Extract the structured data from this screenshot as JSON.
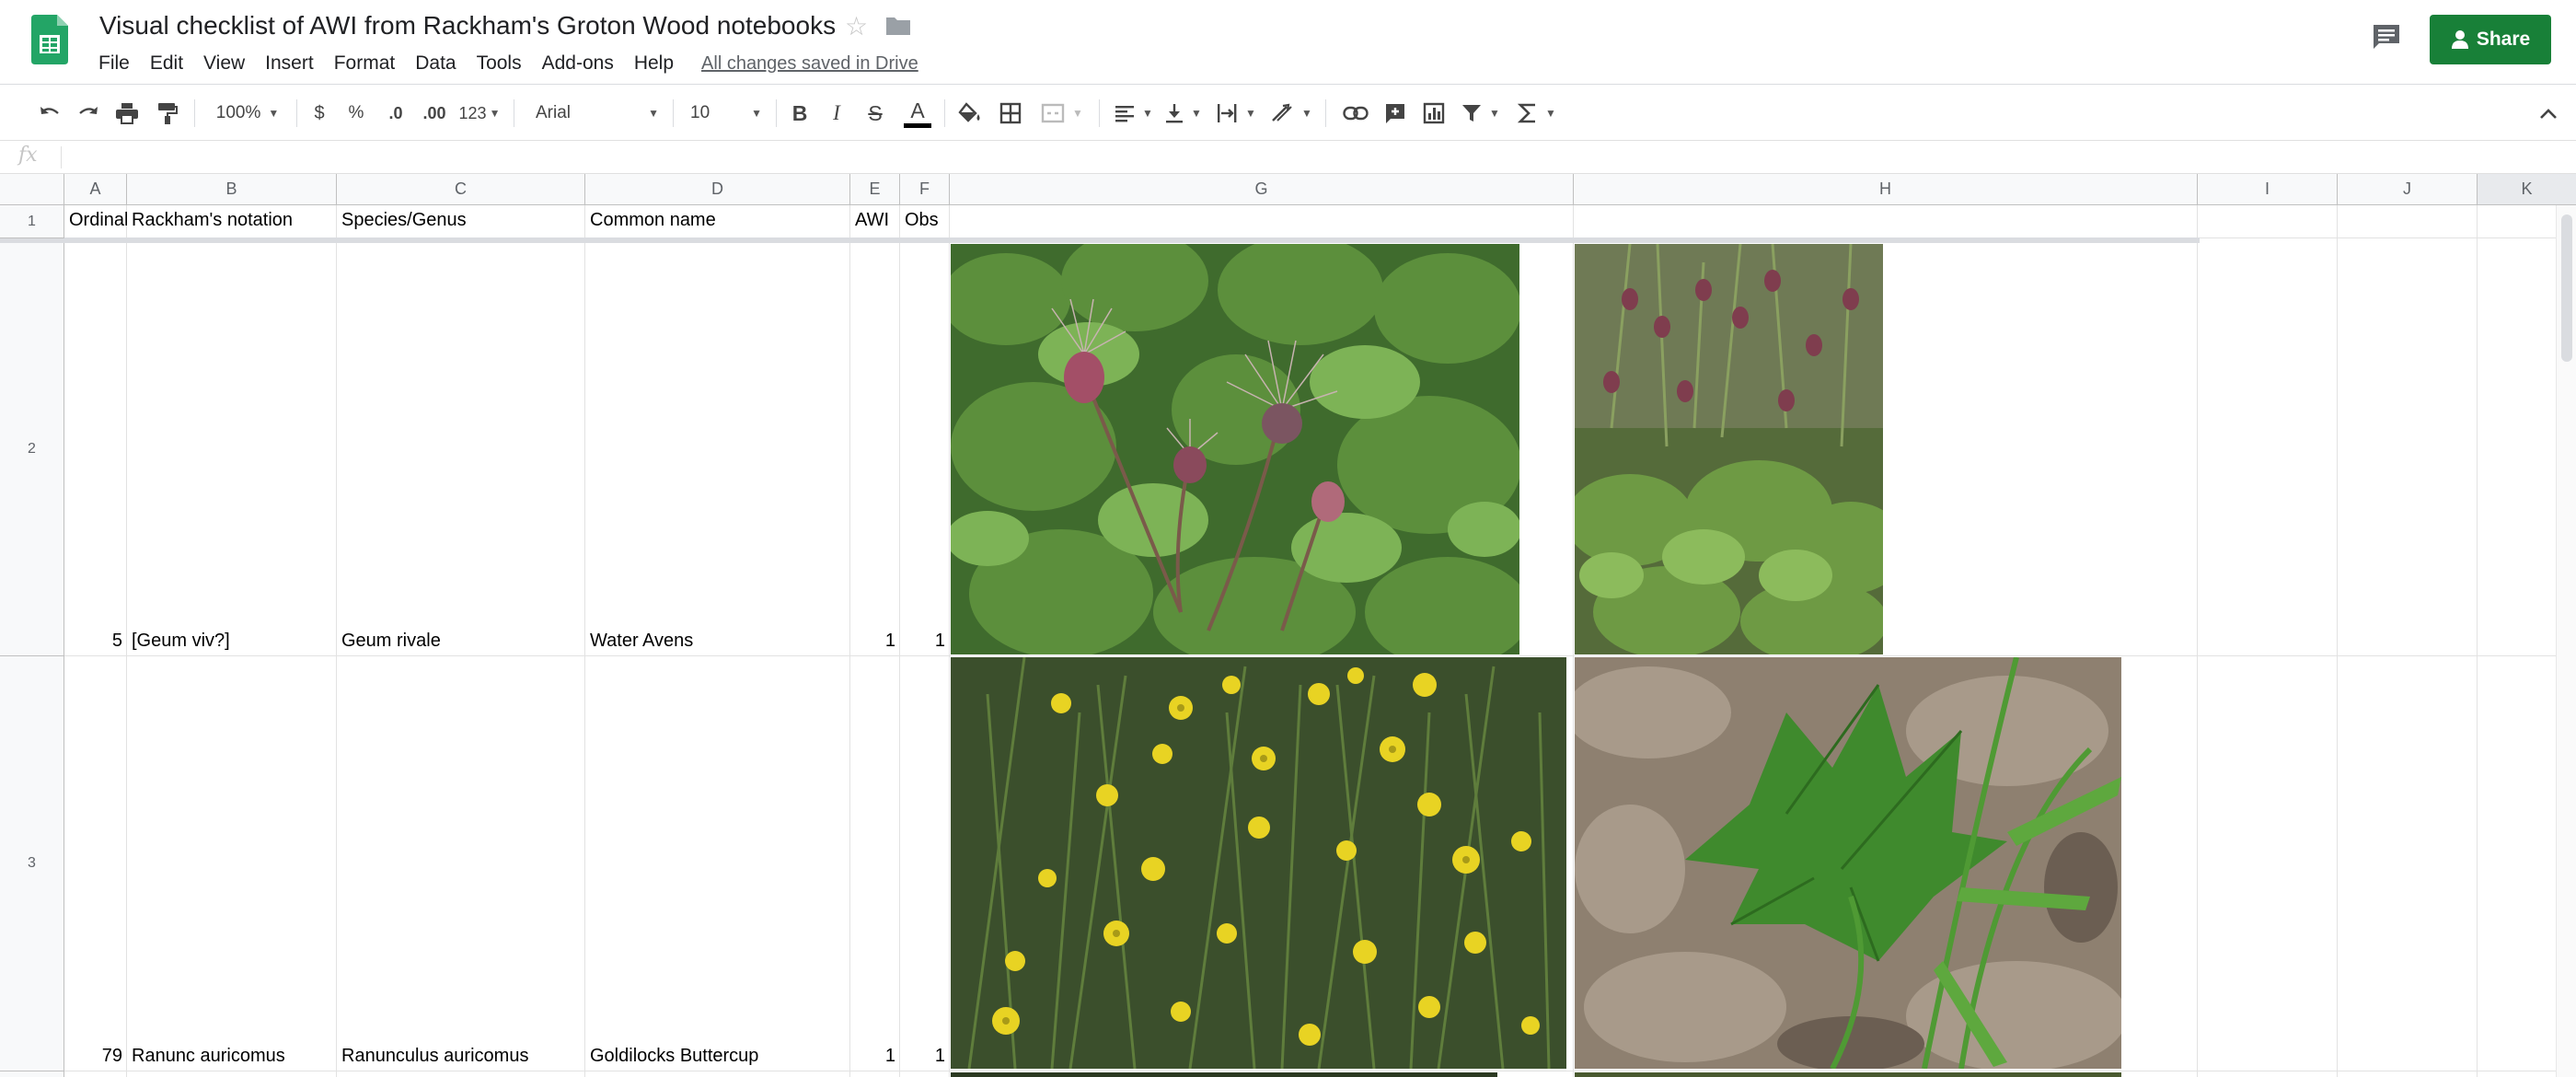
{
  "app": {
    "title": "Visual checklist of AWI from Rackham's Groton Wood notebooks",
    "menu": [
      "File",
      "Edit",
      "View",
      "Insert",
      "Format",
      "Data",
      "Tools",
      "Add-ons",
      "Help"
    ],
    "save_status": "All changes saved in Drive",
    "share_label": "Share",
    "brand_color": "#188038"
  },
  "toolbar": {
    "zoom": "100%",
    "currency": "$",
    "percent": "%",
    "decrease_decimal": ".0",
    "increase_decimal": ".00",
    "more_formats": "123",
    "font": "Arial",
    "font_size": "10",
    "bold": "B",
    "italic": "I",
    "strike": "S",
    "text_color": "A",
    "icons": [
      "undo-icon",
      "redo-icon",
      "print-icon",
      "paint-format-icon",
      "fill-color-icon",
      "borders-icon",
      "merge-cells-icon",
      "horizontal-align-icon",
      "vertical-align-icon",
      "text-wrapping-icon",
      "text-rotation-icon",
      "link-icon",
      "comment-icon",
      "chart-icon",
      "filter-icon",
      "functions-icon",
      "collapse-icon"
    ]
  },
  "formula_bar": {
    "fx": "fx",
    "value": ""
  },
  "grid": {
    "columns": [
      "A",
      "B",
      "C",
      "D",
      "E",
      "F",
      "G",
      "H",
      "I",
      "J",
      "K"
    ],
    "row_numbers": [
      "1",
      "2",
      "3"
    ],
    "header_row": [
      "Ordinal",
      "Rackham's notation",
      "Species/Genus",
      "Common name",
      "AWI",
      "Obs"
    ],
    "rows": [
      {
        "ordinal": "5",
        "notation": "[Geum viv?]",
        "species": "Geum rivale",
        "common": "Water Avens",
        "awi": "1",
        "obs": "1",
        "images": [
          "Water Avens flowering stems close-up",
          "Water Avens plants with nodding flowers"
        ]
      },
      {
        "ordinal": "79",
        "notation": "Ranunc auricomus",
        "species": "Ranunculus auricomus",
        "common": "Goldilocks Buttercup",
        "awi": "1",
        "obs": "1",
        "images": [
          "Goldilocks Buttercup yellow flowers",
          "Goldilocks Buttercup leaf"
        ]
      }
    ]
  }
}
